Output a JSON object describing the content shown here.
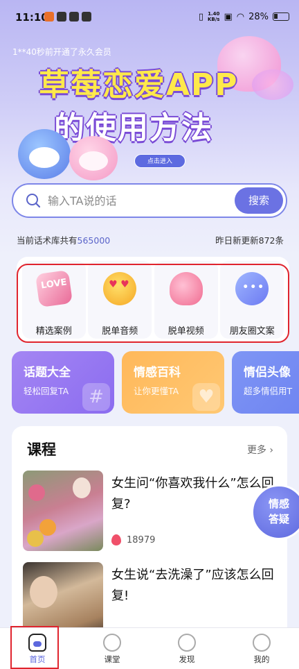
{
  "status_bar": {
    "time": "11:10",
    "net_speed_value": "1.40",
    "net_speed_unit": "KB/s",
    "battery": "28%"
  },
  "banner": {
    "ticker": "1**40秒前开通了永久会员",
    "title_line1": "草莓恋爱APP",
    "title_line2": "的使用方法",
    "enter_button": "点击进入"
  },
  "search": {
    "placeholder": "输入TA说的话",
    "button_label": "搜索"
  },
  "stats": {
    "library_prefix": "当前话术库共有",
    "library_count": "565000",
    "update_text": "昨日新更新872条"
  },
  "categories": [
    {
      "label": "精选案例",
      "icon": "love-cube-icon",
      "glyph": "LOVE"
    },
    {
      "label": "脱单音频",
      "icon": "heart-eyes-emoji-icon",
      "glyph": ""
    },
    {
      "label": "脱单视频",
      "icon": "hearts-icon",
      "glyph": ""
    },
    {
      "label": "朋友圈文案",
      "icon": "chat-bubbles-icon",
      "glyph": ""
    }
  ],
  "features": [
    {
      "title": "话题大全",
      "subtitle": "轻松回复TA",
      "color": "#9a7cf2"
    },
    {
      "title": "情感百科",
      "subtitle": "让你更懂TA",
      "color": "#ffbd62"
    },
    {
      "title": "情侣头像",
      "subtitle": "超多情侣用T",
      "color": "#7489f3"
    }
  ],
  "course": {
    "heading": "课程",
    "more": "更多 ›",
    "items": [
      {
        "title": "女生问“你喜欢我什么”怎么回复?",
        "views": "18979"
      },
      {
        "title": "女生说“去洗澡了”应该怎么回复!",
        "views": ""
      }
    ]
  },
  "float_button": {
    "line1": "情感",
    "line2": "答疑"
  },
  "nav": {
    "tabs": [
      {
        "label": "首页",
        "icon": "home-icon",
        "active": true
      },
      {
        "label": "课堂",
        "icon": "trophy-icon",
        "active": false
      },
      {
        "label": "发现",
        "icon": "search-icon",
        "active": false
      },
      {
        "label": "我的",
        "icon": "profile-icon",
        "active": false
      }
    ]
  },
  "colors": {
    "accent": "#6b72e3",
    "highlight": "#e0242d"
  }
}
